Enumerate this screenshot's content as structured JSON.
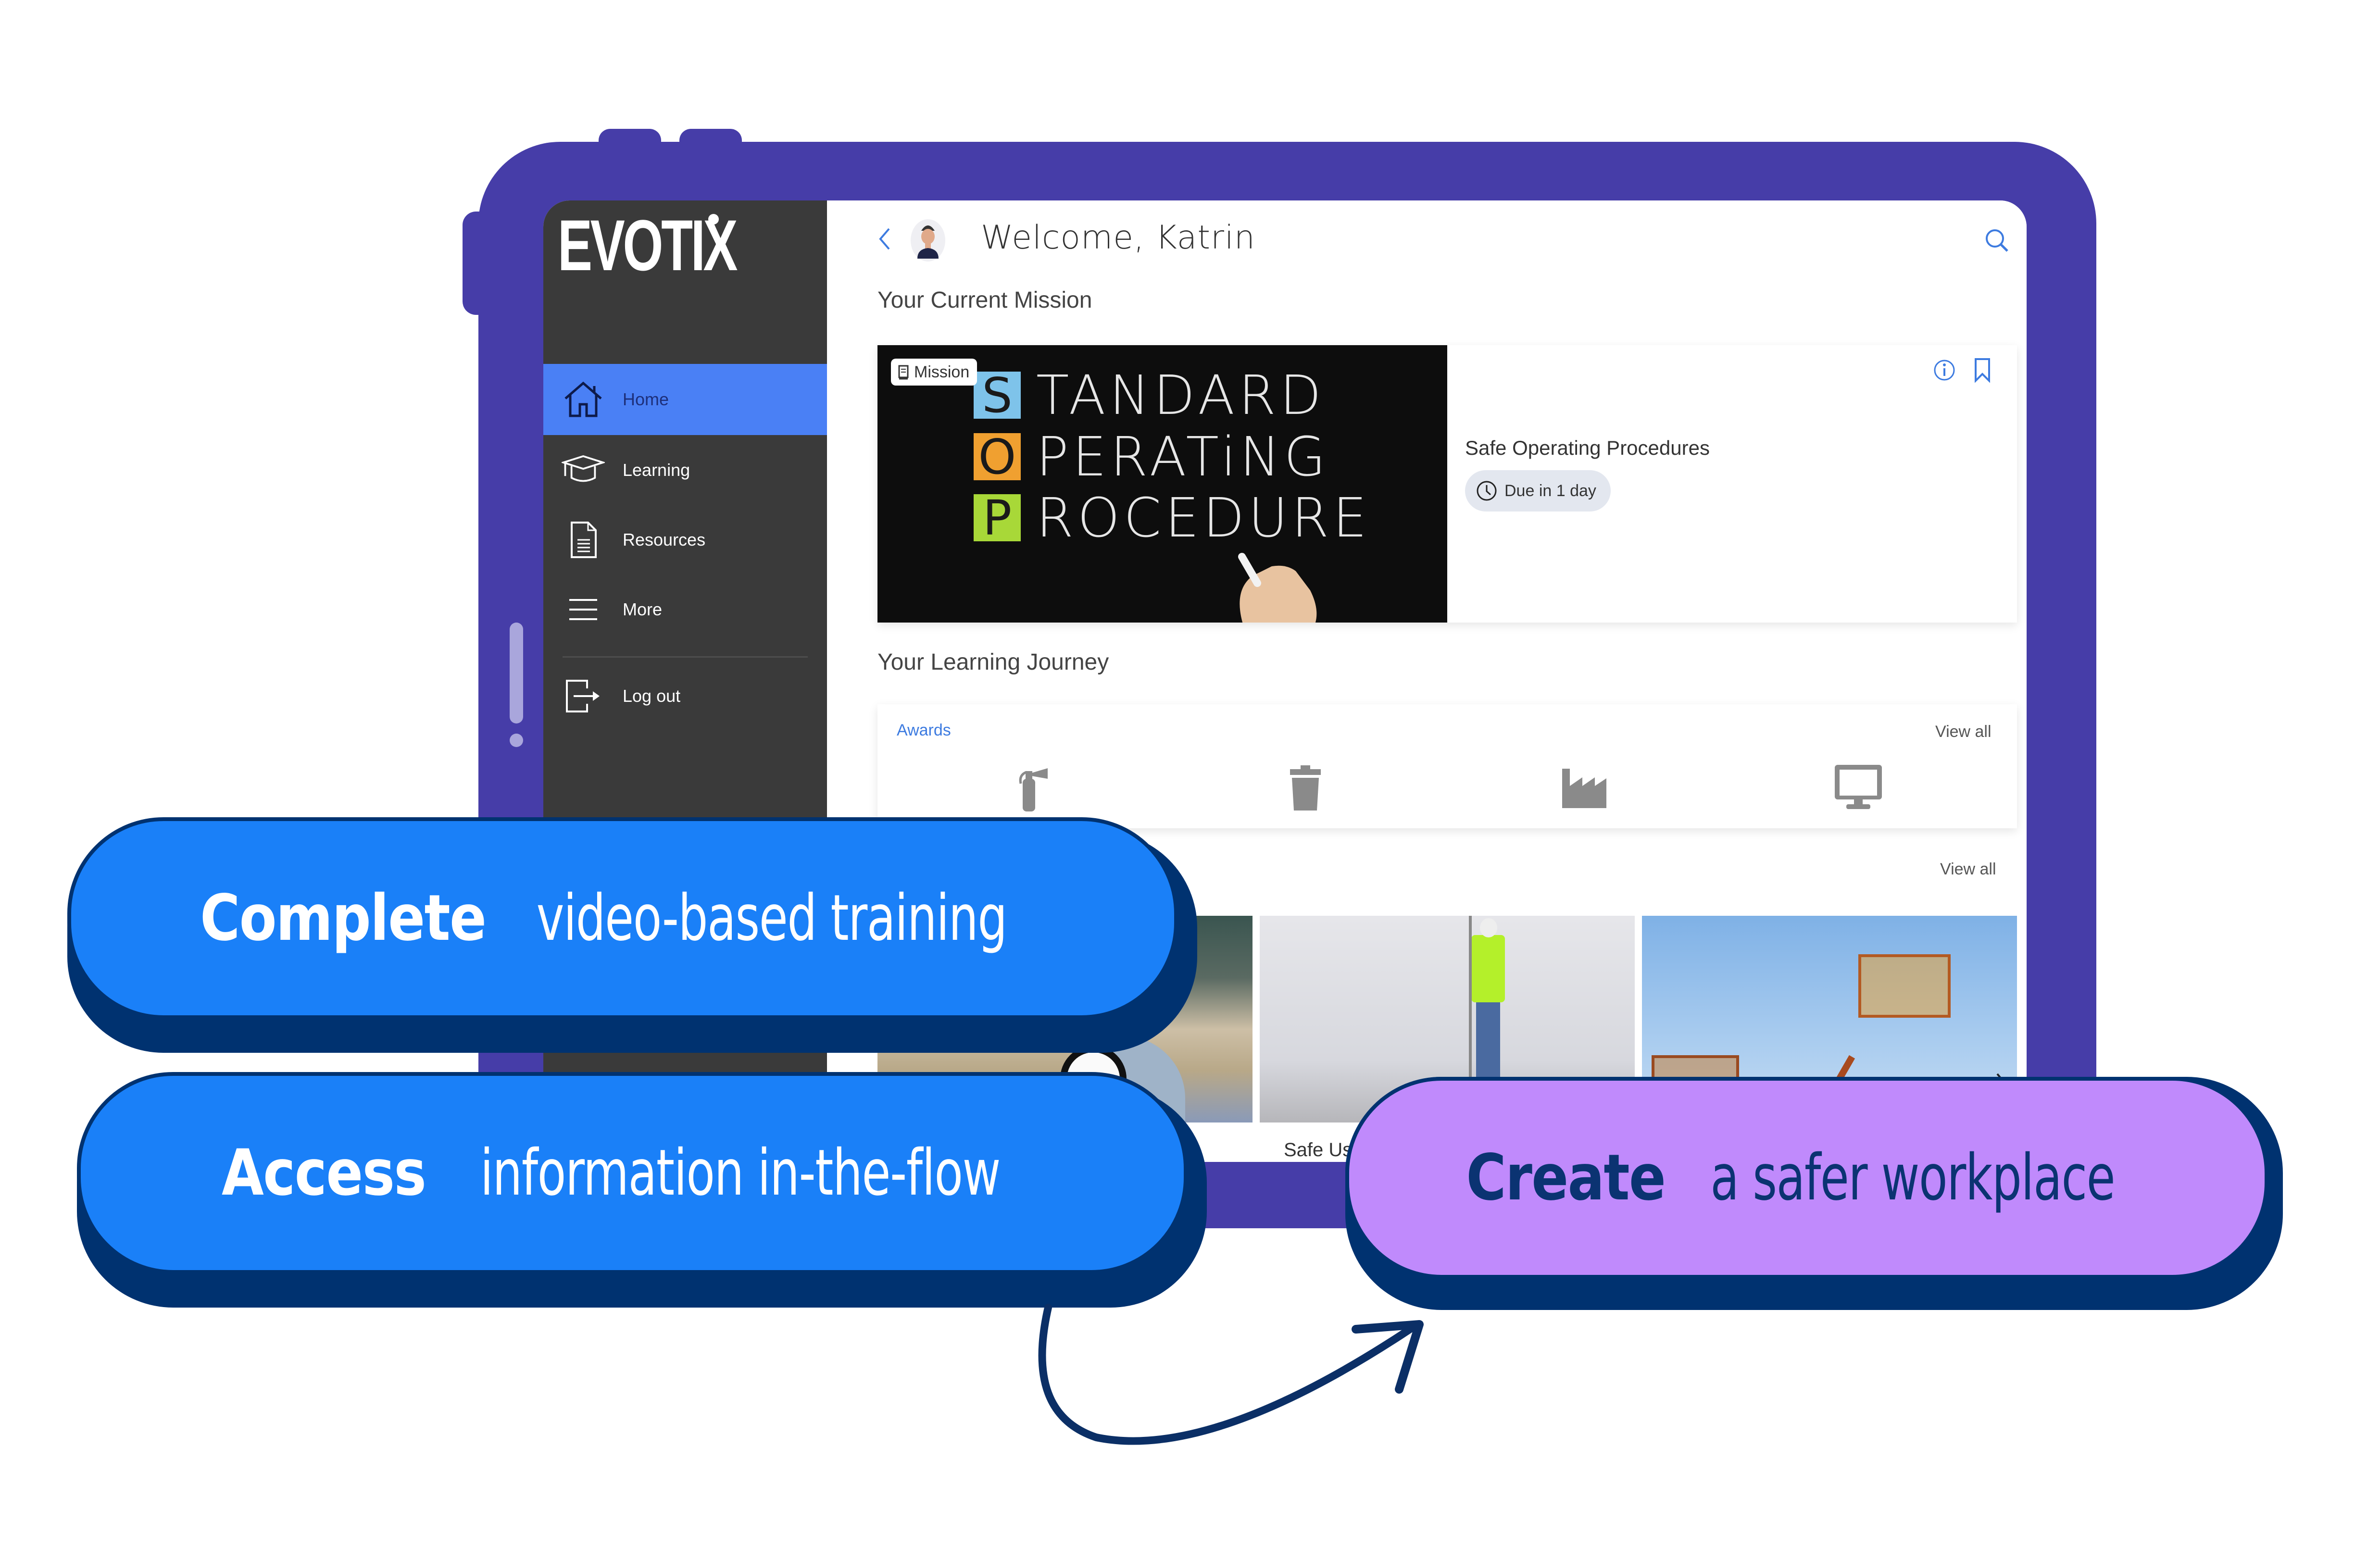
{
  "app": {
    "brand": "EVOTIX"
  },
  "sidebar": {
    "items": [
      {
        "label": "Home",
        "icon": "home-icon",
        "active": true
      },
      {
        "label": "Learning",
        "icon": "graduation-cap-icon",
        "active": false
      },
      {
        "label": "Resources",
        "icon": "document-icon",
        "active": false
      },
      {
        "label": "More",
        "icon": "menu-icon",
        "active": false
      },
      {
        "label": "Log out",
        "icon": "logout-icon",
        "active": false
      }
    ]
  },
  "header": {
    "welcome": "Welcome,  Katrin",
    "back_icon": "chevron-left-icon",
    "search_icon": "search-icon"
  },
  "mission": {
    "section_title": "Your Current Mission",
    "tag": "Mission",
    "image_lines": [
      "TANDARD",
      "PERATiNG",
      "ROCEDURE"
    ],
    "image_initials": [
      "S",
      "O",
      "P"
    ],
    "image_colors": [
      "#7ec3ea",
      "#f0a030",
      "#a8d838"
    ],
    "title": "Safe Operating Procedures",
    "due": "Due in 1 day"
  },
  "journey": {
    "section_title": "Your Learning Journey",
    "awards_label": "Awards",
    "awards_view_all": "View all",
    "awards": [
      {
        "icon": "fire-extinguisher-icon"
      },
      {
        "icon": "trash-bin-icon"
      },
      {
        "icon": "factory-icon"
      },
      {
        "icon": "monitor-icon"
      }
    ],
    "courses_view_all": "View all",
    "courses": [
      {
        "label": ""
      },
      {
        "label": "Safe Use"
      },
      {
        "label": ""
      }
    ]
  },
  "callouts": [
    {
      "strong": "Complete",
      "rest": "video-based training"
    },
    {
      "strong": "Access",
      "rest": "information in-the-flow"
    },
    {
      "strong": "Create",
      "rest": "a safer workplace"
    }
  ],
  "colors": {
    "frame": "#463DA8",
    "sidebar": "#3a3a3a",
    "active_nav": "#4a80f5",
    "pill_blue": "#1a80f8",
    "pill_purple": "#c08afc",
    "navy": "#003270",
    "accent": "#3d7be0"
  }
}
